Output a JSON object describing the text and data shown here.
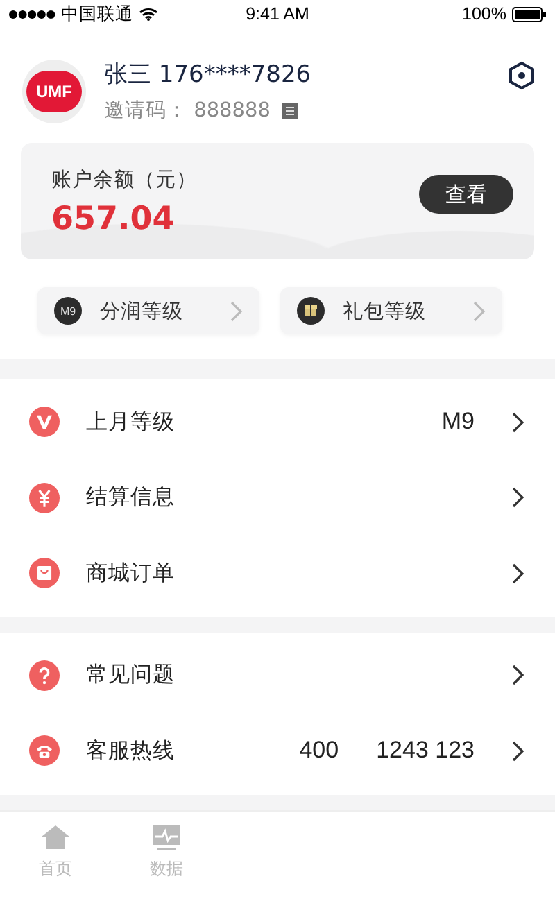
{
  "status_bar": {
    "carrier": "中国联通",
    "time": "9:41 AM",
    "battery": "100%"
  },
  "profile": {
    "avatar": "UMF",
    "name": "张三 176****7826",
    "invite_label": "邀请码：",
    "invite_code": "888888"
  },
  "balance": {
    "label": "账户余额（元）",
    "amount": "657.04",
    "button": "查看"
  },
  "level_buttons": [
    {
      "kind": "m9",
      "badge": "M9",
      "label": "分润等级"
    },
    {
      "kind": "gift",
      "label": "礼包等级"
    }
  ],
  "menu_groups": [
    [
      {
        "kind": "v",
        "label": "上月等级",
        "values": [
          "M9"
        ]
      },
      {
        "kind": "yen",
        "label": "结算信息"
      },
      {
        "kind": "bag",
        "label": "商城订单"
      }
    ],
    [
      {
        "kind": "question",
        "label": "常见问题"
      },
      {
        "kind": "phone",
        "label": "客服热线",
        "values": [
          "400",
          "1243 123"
        ]
      }
    ]
  ],
  "tab_bar": [
    {
      "kind": "home",
      "label": "首页",
      "selected": false
    },
    {
      "kind": "data",
      "label": "数据",
      "selected": false
    }
  ]
}
